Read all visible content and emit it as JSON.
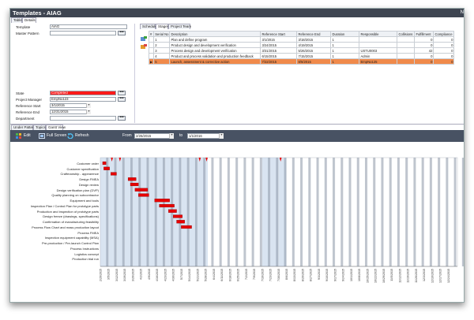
{
  "window": {
    "title": "Templates - AIAG",
    "corner": "N"
  },
  "top_tabs": [
    {
      "label": "Table",
      "active": false
    },
    {
      "label": "Details",
      "active": true
    }
  ],
  "details": {
    "template_label": "Template",
    "template_value": "AIAG",
    "master_pattern_label": "Master Pattern",
    "master_pattern_value": "",
    "state_label": "State",
    "state_value": "Completed",
    "state_color": "#ff1a1a",
    "pm_label": "Project Manager",
    "pm_value": "EmpNo123",
    "ref_start_label": "Reference Start",
    "ref_start_value": "3/1/2015",
    "ref_end_label": "Reference End",
    "ref_end_value": "12/31/2015",
    "department_label": "Department",
    "department_value": ""
  },
  "grid_tabs": [
    {
      "label": "Schedule",
      "active": false
    },
    {
      "label": "Stages",
      "active": true
    },
    {
      "label": "Project Team",
      "active": false
    }
  ],
  "grid": {
    "columns": [
      "#",
      "Serial No",
      "Description",
      "Reference Start",
      "Reference End",
      "Duration",
      "Responsible",
      "Collisions",
      "Fulfillment",
      "Compliance"
    ],
    "rows": [
      {
        "serial": "1",
        "desc": "Plan and define program",
        "start": "3/1/2015",
        "end": "3/18/2015",
        "dur": "1",
        "resp": "",
        "coll": "",
        "ful": "0",
        "comp": "0",
        "sel": false
      },
      {
        "serial": "2",
        "desc": "Product design and development verification",
        "start": "3/24/2015",
        "end": "4/19/2015",
        "dur": "1",
        "resp": "",
        "coll": "",
        "ful": "0",
        "comp": "0",
        "sel": false
      },
      {
        "serial": "3",
        "desc": "Process design and development verification",
        "start": "3/31/2015",
        "end": "5/26/2015",
        "dur": "1",
        "resp": "USTU0003",
        "coll": "",
        "ful": "42",
        "comp": "0",
        "sel": false
      },
      {
        "serial": "4",
        "desc": "Product and process validation and production feedback",
        "start": "6/15/2015",
        "end": "7/15/2015",
        "dur": "1",
        "resp": "Admin",
        "coll": "",
        "ful": "0",
        "comp": "0",
        "sel": false
      },
      {
        "serial": "5",
        "desc": "Launch, assessment & corrective action",
        "start": "7/22/2015",
        "end": "8/5/2015",
        "dur": "1",
        "resp": "EmpNo125",
        "coll": "",
        "ful": "0",
        "comp": "0",
        "sel": true
      }
    ],
    "row_marker": "▶"
  },
  "bottom_tabs": [
    {
      "label": "Under Pattern",
      "active": false
    },
    {
      "label": "Topics",
      "active": false
    },
    {
      "label": "Gantt View",
      "active": true
    }
  ],
  "toolbar": {
    "edit": "Edit",
    "fullscreen": "Full Screen",
    "refresh": "Refresh",
    "from_label": "From",
    "from_value": "2/26/2015",
    "to_label": "to",
    "to_value": "1/1/2016"
  },
  "colors": {
    "accent": "#485263",
    "bar": "#e60000",
    "highlight": "#f08a4b",
    "stripe": "#aac4e0"
  },
  "chart_data": {
    "type": "gantt",
    "tasks": [
      {
        "name": "Customer order",
        "start": "2/28/2015",
        "end": "3/3/2015"
      },
      {
        "name": "Customer specification",
        "start": "3/1/2015",
        "end": "3/6/2015"
      },
      {
        "name": "Craftmanship - appearence",
        "start": "3/7/2015",
        "end": "3/12/2015"
      },
      {
        "name": "Design FMEA",
        "start": "3/22/2015",
        "end": "3/29/2015"
      },
      {
        "name": "Design review",
        "start": "3/24/2015",
        "end": "3/31/2015"
      },
      {
        "name": "Design verification plan (DVP)",
        "start": "3/28/2015",
        "end": "4/8/2015"
      },
      {
        "name": "Quality planning on subcontractor",
        "start": "3/31/2015",
        "end": "4/9/2015"
      },
      {
        "name": "Equipment and tools",
        "start": "4/14/2015",
        "end": "4/27/2015"
      },
      {
        "name": "Inspection Plan / Control Plan for prototype parts",
        "start": "4/18/2015",
        "end": "5/1/2015"
      },
      {
        "name": "Production and inspection of prototype parts",
        "start": "4/26/2015",
        "end": "5/3/2015"
      },
      {
        "name": "Design freeze (drawings, specifications)",
        "start": "4/30/2015",
        "end": "5/8/2015"
      },
      {
        "name": "Confirmation of manufacturing feasibility",
        "start": "5/3/2015",
        "end": "5/10/2015"
      },
      {
        "name": "Process Flow Chart and mass production layout",
        "start": "5/7/2015",
        "end": "5/16/2015"
      },
      {
        "name": "Process FMEA",
        "start": "",
        "end": ""
      },
      {
        "name": "Inspection equipment capability (MSA)",
        "start": "",
        "end": ""
      },
      {
        "name": "Pre-production / Pre-launch Control Plan",
        "start": "",
        "end": ""
      },
      {
        "name": "Process Instructions",
        "start": "",
        "end": ""
      },
      {
        "name": "Logistics concept",
        "start": "",
        "end": ""
      },
      {
        "name": "Production trial run",
        "start": "",
        "end": ""
      }
    ],
    "x_ticks": [
      "2/26/2015",
      "3/5/2015",
      "3/12/2015",
      "3/19/2015",
      "3/26/2015",
      "4/2/2015",
      "4/9/2015",
      "4/16/2015",
      "4/23/2015",
      "4/30/2015",
      "5/7/2015",
      "5/14/2015",
      "5/21/2015",
      "5/28/2015",
      "6/4/2015",
      "6/11/2015",
      "6/18/2015",
      "6/25/2015",
      "7/2/2015",
      "7/9/2015",
      "7/16/2015",
      "7/23/2015",
      "7/30/2015",
      "8/6/2015",
      "8/13/2015",
      "8/20/2015",
      "8/27/2015",
      "9/3/2015",
      "9/10/2015",
      "9/17/2015",
      "9/24/2015",
      "10/1/2015",
      "10/8/2015",
      "10/15/2015",
      "10/22/2015",
      "10/29/2015",
      "11/5/2015",
      "11/12/2015",
      "11/19/2015",
      "11/26/2015",
      "12/3/2015",
      "12/10/2015",
      "12/17/2015",
      "12/24/2015"
    ],
    "x_range": [
      "2/26/2015",
      "1/1/2016"
    ],
    "milestones": [
      "3/8/2015",
      "3/15/2015",
      "5/23/2015",
      "5/29/2015",
      "8/1/2015"
    ],
    "highlight_ranges": [
      [
        "2/26/2015",
        "5/30/2015"
      ],
      [
        "7/16/2015",
        "8/6/2015"
      ]
    ]
  }
}
